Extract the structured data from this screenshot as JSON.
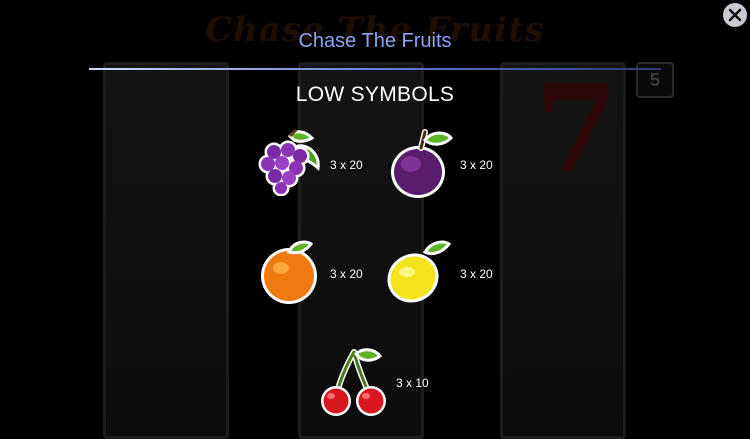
{
  "popup": {
    "title": "Chase The Fruits",
    "section_title": "LOW SYMBOLS",
    "close_icon": "close-icon",
    "symbols": [
      {
        "icon": "grapes-icon",
        "payout": "3 x 20"
      },
      {
        "icon": "plum-icon",
        "payout": "3 x 20"
      },
      {
        "icon": "orange-icon",
        "payout": "3 x 20"
      },
      {
        "icon": "lemon-icon",
        "payout": "3 x 20"
      },
      {
        "icon": "cherries-icon",
        "payout": "3 x 10"
      }
    ]
  },
  "background": {
    "game_logo": "Chase The Fruits",
    "counter": "5"
  },
  "colors": {
    "title": "#8aa4f5",
    "divider": "#5a6cc8",
    "close_button": "#c9c9d3"
  }
}
